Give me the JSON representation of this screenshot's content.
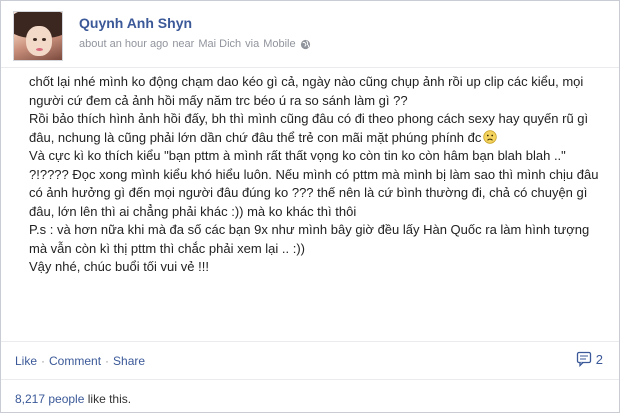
{
  "post": {
    "author": "Quynh Anh Shyn",
    "time": "about an hour ago",
    "location_prefix": "near",
    "location": "Mai Dich",
    "via_prefix": "via",
    "via": "Mobile",
    "paragraphs": [
      "chốt lại nhé mình ko động chạm dao kéo gì cả, ngày nào cũng chụp ảnh rồi up clip các kiểu, mọi người cứ đem cả ảnh hồi mấy năm trc béo ú ra so sánh làm gì ??",
      "Rồi bảo thích hình ảnh hồi đấy, bh thì mình cũng đâu có đi theo phong cách sexy hay quyến rũ gì đâu, nchung là cũng phải lớn dần chứ đâu thể trẻ con mãi mặt phúng phính đc",
      "Và cực kì ko thích kiểu \"bạn pttm à mình rất thất vọng ko còn tin ko còn hâm bạn blah blah ..\" ?!???? Đọc xong mình kiểu khó hiểu luôn. Nếu mình có pttm mà mình bị làm sao thì mình chịu đâu có ảnh hưởng gì đến mọi người đâu đúng ko ??? thế nên là cứ bình thường đi, chả có chuyện gì đâu, lớn lên thì ai chẳng phải khác :)) mà ko khác thì thôi",
      "P.s : và hơn nữa khi mà đa số các bạn 9x như mình bây giờ đều lấy Hàn Quốc ra làm hình tượng mà vẫn còn kì thị pttm thì chắc phải xem lại .. :))",
      "Vậy nhé, chúc buổi tối vui vẻ !!!"
    ],
    "emoticon": "frown-emoticon-icon"
  },
  "actions": {
    "like": "Like",
    "comment": "Comment",
    "share": "Share",
    "separator": "·",
    "comment_count": "2"
  },
  "likes": {
    "count": "8,217 people",
    "suffix": " like this."
  },
  "colors": {
    "link": "#3b5998",
    "meta": "#90949c"
  }
}
